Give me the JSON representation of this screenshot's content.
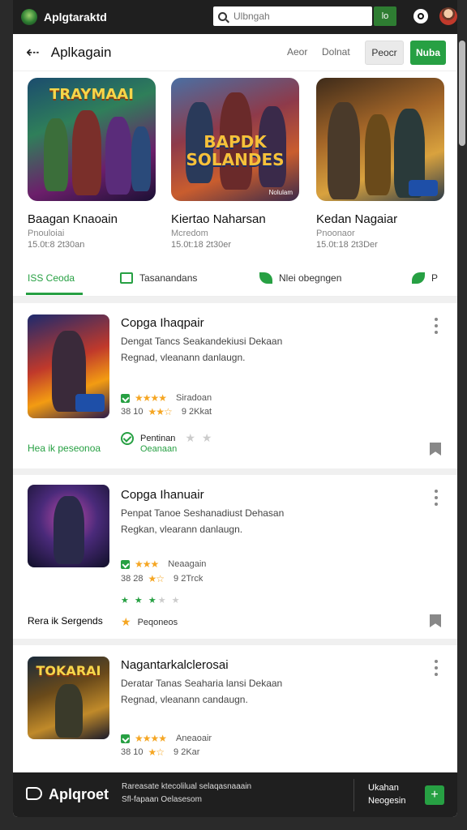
{
  "topbar": {
    "app_title": "Aplgtaraktd",
    "search_placeholder": "Ulbngah",
    "search_button": "lo"
  },
  "header": {
    "title": "Aplkagain",
    "link1": "Aeor",
    "link2": "Dolnat",
    "button1": "Peocr",
    "button2": "Nuba"
  },
  "featured": [
    {
      "art": "TRAYMAAI",
      "name": "Baagan Knaoain",
      "sub": "Pnouloiai",
      "meta": "15.0t:8 2t30an"
    },
    {
      "art": "BAPDK SOLANDES",
      "name": "Kiertao Naharsan",
      "sub": "Mcredom",
      "meta": "15.0t:18 2t30er",
      "badge": "Nolulam"
    },
    {
      "art": "",
      "name": "Kedan Nagaiar",
      "sub": "Pnoonaor",
      "meta": "15.0t:18 2t3Der"
    }
  ],
  "tabs": [
    {
      "label": "ISS Ceoda",
      "active": true
    },
    {
      "label": "Tasanandans"
    },
    {
      "label": "Nlei  obegngen"
    },
    {
      "label": "P"
    }
  ],
  "cards": [
    {
      "title": "Copga Ihaqpair",
      "desc1": "Dengat Tancs Seakandekiusi Dekaan",
      "desc2": "Regnad, vleanann danlaugn.",
      "rating_label": "Siradoan",
      "rating_nums": "38  10",
      "rating_count": "9 2Kkat",
      "status1": "Pentinan",
      "status2": "Oeanaan",
      "left_label": "Hea ik peseonoa",
      "left_label_color": "#27a043"
    },
    {
      "title": "Copga Ihanuair",
      "desc1": "Penpat Tanoe Seshanadiust Dehasan",
      "desc2": "Regkan, vlearann danlaugn.",
      "rating_label": "Neaagain",
      "rating_nums": "38  28",
      "rating_count": "9 2Trck",
      "status1": "Peqoneos",
      "left_label": "Rera ik Sergends",
      "left_label_color": "#333333"
    },
    {
      "title": "Nagantarkalclerosai",
      "desc1": "Deratar Tanas Seaharia lansi Dekaan",
      "desc2": "Regnad, vleanann candaugn.",
      "rating_label": "Aneaoair",
      "rating_nums": "38  10",
      "rating_count": "9 2Kar"
    }
  ],
  "bottombar": {
    "title": "Aplqroet",
    "text1": "Rareasate ktecolilual selaqasnaaain",
    "text2": "Sfl-fapaan Oelasesom",
    "right1": "Ukahan",
    "right2": "Neogesin",
    "plus": "+"
  }
}
